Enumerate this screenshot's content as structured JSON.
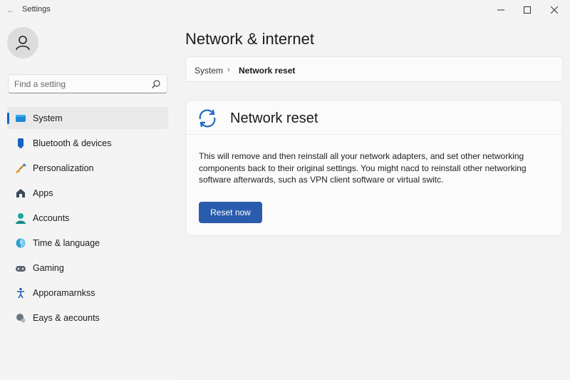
{
  "window": {
    "title": "Settings",
    "controls": {
      "minimize": "minimize-icon",
      "maximize": "maximize-icon",
      "close": "close-icon"
    }
  },
  "sidebar": {
    "search": {
      "placeholder": "Find a setting",
      "value": ""
    },
    "items": [
      {
        "label": "System",
        "icon": "system-icon",
        "active": true
      },
      {
        "label": "Bluetooth & devices",
        "icon": "bluetooth-icon",
        "active": false
      },
      {
        "label": "Personalization",
        "icon": "brush-icon",
        "active": false
      },
      {
        "label": "Apps",
        "icon": "apps-icon",
        "active": false
      },
      {
        "label": "Accounts",
        "icon": "account-icon",
        "active": false
      },
      {
        "label": "Time & language",
        "icon": "globe-icon",
        "active": false
      },
      {
        "label": "Gaming",
        "icon": "gamepad-icon",
        "active": false
      },
      {
        "label": "Apporamarnkss",
        "icon": "accessibility-icon",
        "active": false
      },
      {
        "label": "Eays & aecounts",
        "icon": "privacy-icon",
        "active": false
      }
    ]
  },
  "main": {
    "page_title": "Network & internet",
    "breadcrumb": {
      "first": "System",
      "separator": "›",
      "current": "Network reset"
    },
    "card": {
      "title": "Network reset",
      "description": "This will remove and then reinstall all your network adapters, and set other networking components back to their original settings. You might nacd to reinstall other networking software afterwards, such as VPN client software or virtual switc.",
      "button_label": "Reset now"
    }
  },
  "colors": {
    "accent": "#0067c0",
    "button": "#2a5cad",
    "background": "#f3f3f3",
    "card": "#fbfbfb"
  }
}
